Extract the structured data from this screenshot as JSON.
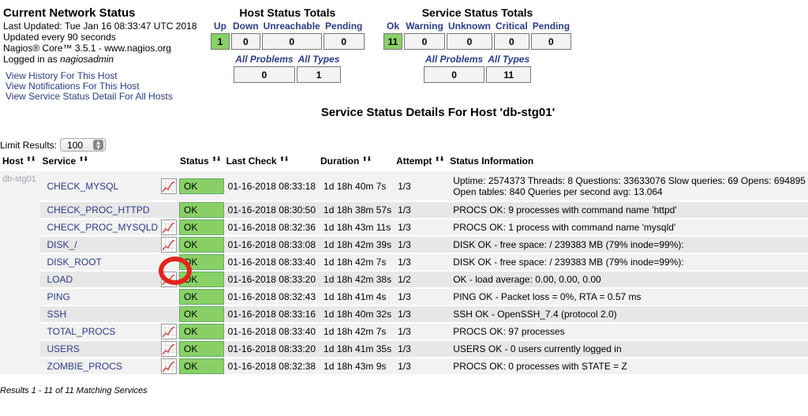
{
  "info": {
    "title": "Current Network Status",
    "last_updated": "Last Updated: Tue Jan 16 08:33:47 UTC 2018",
    "update_interval": "Updated every 90 seconds",
    "product": "Nagios® Core™ 3.5.1 - www.nagios.org",
    "logged_in_prefix": "Logged in as ",
    "user": "nagiosadmin"
  },
  "links": {
    "history": "View History For This Host",
    "notifications": "View Notifications For This Host",
    "service_detail": "View Service Status Detail For All Hosts"
  },
  "host_totals": {
    "title": "Host Status Totals",
    "labels": {
      "up": "Up",
      "down": "Down",
      "unreachable": "Unreachable",
      "pending": "Pending"
    },
    "values": {
      "up": "1",
      "down": "0",
      "unreachable": "0",
      "pending": "0"
    },
    "all_problems_label": "All Problems",
    "all_types_label": "All Types",
    "all_problems": "0",
    "all_types": "1"
  },
  "service_totals": {
    "title": "Service Status Totals",
    "labels": {
      "ok": "Ok",
      "warning": "Warning",
      "unknown": "Unknown",
      "critical": "Critical",
      "pending": "Pending"
    },
    "values": {
      "ok": "11",
      "warning": "0",
      "unknown": "0",
      "critical": "0",
      "pending": "0"
    },
    "all_problems_label": "All Problems",
    "all_types_label": "All Types",
    "all_problems": "0",
    "all_types": "11"
  },
  "page_title": "Service Status Details For Host 'db-stg01'",
  "limit": {
    "label": "Limit Results:",
    "value": "100"
  },
  "columns": {
    "host": "Host",
    "service": "Service",
    "status": "Status",
    "last_check": "Last Check",
    "duration": "Duration",
    "attempt": "Attempt",
    "info": "Status Information"
  },
  "host_name": "db-stg01",
  "rows": [
    {
      "service": "CHECK_MYSQL",
      "graph": true,
      "status": "OK",
      "last_check": "01-16-2018 08:33:18",
      "duration": "1d 18h 40m 7s",
      "attempt": "1/3",
      "info": "Uptime: 2574373 Threads: 8 Questions: 33633076 Slow queries: 69 Opens: 694895",
      "info2": "Open tables: 840 Queries per second avg: 13.064"
    },
    {
      "service": "CHECK_PROC_HTTPD",
      "graph": false,
      "status": "OK",
      "last_check": "01-16-2018 08:30:50",
      "duration": "1d 18h 38m 57s",
      "attempt": "1/3",
      "info": "PROCS OK: 9 processes with command name 'httpd'"
    },
    {
      "service": "CHECK_PROC_MYSQLD",
      "graph": true,
      "status": "OK",
      "last_check": "01-16-2018 08:32:36",
      "duration": "1d 18h 43m 11s",
      "attempt": "1/3",
      "info": "PROCS OK: 1 process with command name 'mysqld'"
    },
    {
      "service": "DISK_/",
      "graph": true,
      "status": "OK",
      "last_check": "01-16-2018 08:33:08",
      "duration": "1d 18h 42m 39s",
      "attempt": "1/3",
      "info": "DISK OK - free space: / 239383 MB (79% inode=99%):"
    },
    {
      "service": "DISK_ROOT",
      "graph": false,
      "status": "OK",
      "last_check": "01-16-2018 08:33:40",
      "duration": "1d 18h 42m 7s",
      "attempt": "1/3",
      "info": "DISK OK - free space: / 239383 MB (79% inode=99%):"
    },
    {
      "service": "LOAD",
      "graph": true,
      "status": "OK",
      "last_check": "01-16-2018 08:33:20",
      "duration": "1d 18h 42m 38s",
      "attempt": "1/2",
      "info": "OK - load average: 0.00, 0.00, 0.00"
    },
    {
      "service": "PING",
      "graph": false,
      "status": "OK",
      "last_check": "01-16-2018 08:32:43",
      "duration": "1d 18h 41m 4s",
      "attempt": "1/3",
      "info": "PING OK - Packet loss = 0%, RTA = 0.57 ms"
    },
    {
      "service": "SSH",
      "graph": false,
      "status": "OK",
      "last_check": "01-16-2018 08:33:16",
      "duration": "1d 18h 40m 32s",
      "attempt": "1/3",
      "info": "SSH OK - OpenSSH_7.4 (protocol 2.0)"
    },
    {
      "service": "TOTAL_PROCS",
      "graph": true,
      "status": "OK",
      "last_check": "01-16-2018 08:33:40",
      "duration": "1d 18h 42m 7s",
      "attempt": "1/3",
      "info": "PROCS OK: 97 processes"
    },
    {
      "service": "USERS",
      "graph": true,
      "status": "OK",
      "last_check": "01-16-2018 08:33:20",
      "duration": "1d 18h 41m 35s",
      "attempt": "1/3",
      "info": "USERS OK - 0 users currently logged in"
    },
    {
      "service": "ZOMBIE_PROCS",
      "graph": true,
      "status": "OK",
      "last_check": "01-16-2018 08:32:38",
      "duration": "1d 18h 43m 9s",
      "attempt": "1/3",
      "info": "PROCS OK: 0 processes with STATE = Z"
    }
  ],
  "results": "Results 1 - 11 of 11 Matching Services",
  "colors": {
    "ok": "#88d066",
    "link": "#2a3b86",
    "annotation": "#e5231d"
  }
}
